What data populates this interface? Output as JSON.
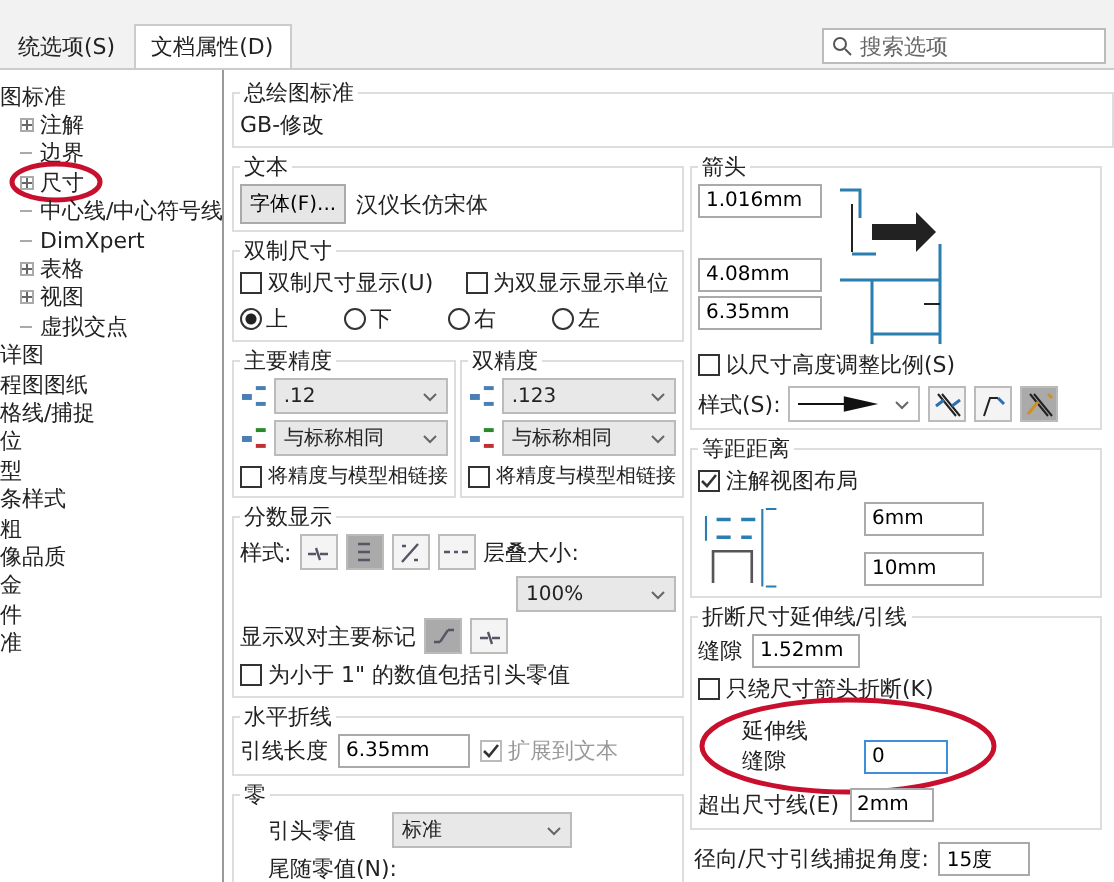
{
  "tabs": [
    {
      "label": "统选项(S)",
      "selected": false
    },
    {
      "label": "文档属性(D)",
      "selected": true
    }
  ],
  "search": {
    "placeholder": "搜索选项"
  },
  "tree": [
    {
      "label": "图标准",
      "children": [
        {
          "label": "注解",
          "expanded": false,
          "circled": false
        },
        {
          "label": "边界",
          "circled": false
        },
        {
          "label": "尺寸",
          "expanded": false,
          "circled": true
        },
        {
          "label": "中心线/中心符号线",
          "circled": false
        },
        {
          "label": "DimXpert",
          "circled": false
        },
        {
          "label": "表格",
          "expanded": false,
          "circled": false
        },
        {
          "label": "视图",
          "expanded": false,
          "circled": false
        },
        {
          "label": "虚拟交点",
          "circled": false
        }
      ]
    },
    {
      "label": "详图"
    },
    {
      "label": "程图图纸"
    },
    {
      "label": "格线/捕捉"
    },
    {
      "label": "位"
    },
    {
      "label": "型"
    },
    {
      "label": "条样式"
    },
    {
      "label": "粗"
    },
    {
      "label": "像品质"
    },
    {
      "label": "金"
    },
    {
      "label": "件"
    },
    {
      "label": "准"
    }
  ],
  "standard": {
    "label": "总绘图标准",
    "value": "GB-修改"
  },
  "text": {
    "label": "文本",
    "font_button": "字体(F)...",
    "font_name": "汉仪长仿宋体"
  },
  "dual": {
    "label": "双制尺寸",
    "checks": [
      {
        "label": "双制尺寸显示(U)",
        "checked": false
      },
      {
        "label": "为双显示显示单位",
        "checked": false
      }
    ],
    "positions": [
      {
        "label": "上",
        "selected": true
      },
      {
        "label": "下",
        "selected": false
      },
      {
        "label": "右",
        "selected": false
      },
      {
        "label": "左",
        "selected": false
      }
    ]
  },
  "precision": [
    {
      "label": "主要精度",
      "value": ".12",
      "tolerance": "与标称相同",
      "link": {
        "label": "将精度与模型相链接",
        "checked": false
      }
    },
    {
      "label": "双精度",
      "value": ".123",
      "tolerance": "与标称相同",
      "link": {
        "label": "将精度与模型相链接",
        "checked": false
      }
    }
  ],
  "fraction": {
    "label": "分数显示",
    "style_label": "样式:",
    "styles": [
      {
        "kind": "inline",
        "selected": false
      },
      {
        "kind": "stacked",
        "selected": true
      },
      {
        "kind": "diagonal",
        "selected": false
      },
      {
        "kind": "dash",
        "selected": false
      }
    ],
    "stack_label": "层叠大小:",
    "stack_size": "100%",
    "dual_label": "显示双对主要标记",
    "dual_styles": [
      {
        "kind": "slanted",
        "selected": true
      },
      {
        "kind": "inline",
        "selected": false
      }
    ],
    "leading": {
      "label": "为小于 1\" 的数值包括引头零值",
      "checked": false
    }
  },
  "jog": {
    "label": "水平折线",
    "length_label": "引线长度",
    "length": "6.35mm",
    "extend": {
      "label": "扩展到文本",
      "checked": true,
      "disabled": true
    }
  },
  "zeros": {
    "label": "零",
    "leading_label": "引头零值",
    "leading": "标准",
    "trailing_label": "尾随零值(N):"
  },
  "arrows": {
    "label": "箭头",
    "sizes": [
      "1.016mm",
      "4.08mm",
      "6.35mm"
    ],
    "scale": {
      "label": "以尺寸高度调整比例(S)",
      "checked": false
    },
    "style_label": "样式(S):",
    "placement": [
      {
        "kind": "inside",
        "selected": false
      },
      {
        "kind": "outside",
        "selected": false
      },
      {
        "kind": "smart",
        "selected": true
      }
    ]
  },
  "offset": {
    "label": "等距距离",
    "layout": {
      "label": "注解视图布局",
      "checked": true
    },
    "distances": [
      "6mm",
      "10mm"
    ]
  },
  "break": {
    "label": "折断尺寸延伸线/引线",
    "gap_label": "缝隙",
    "gap": "1.52mm",
    "arrow_only": {
      "label": "只绕尺寸箭头折断(K)",
      "checked": false
    },
    "ext_label": "延伸线",
    "ext_gap_label": "缝隙",
    "ext_gap": "0",
    "ext_circled": true,
    "beyond_label": "超出尺寸线(E)",
    "beyond": "2mm"
  },
  "radial": {
    "label": "径向/尺寸引线捕捉角度:",
    "value": "15度"
  }
}
